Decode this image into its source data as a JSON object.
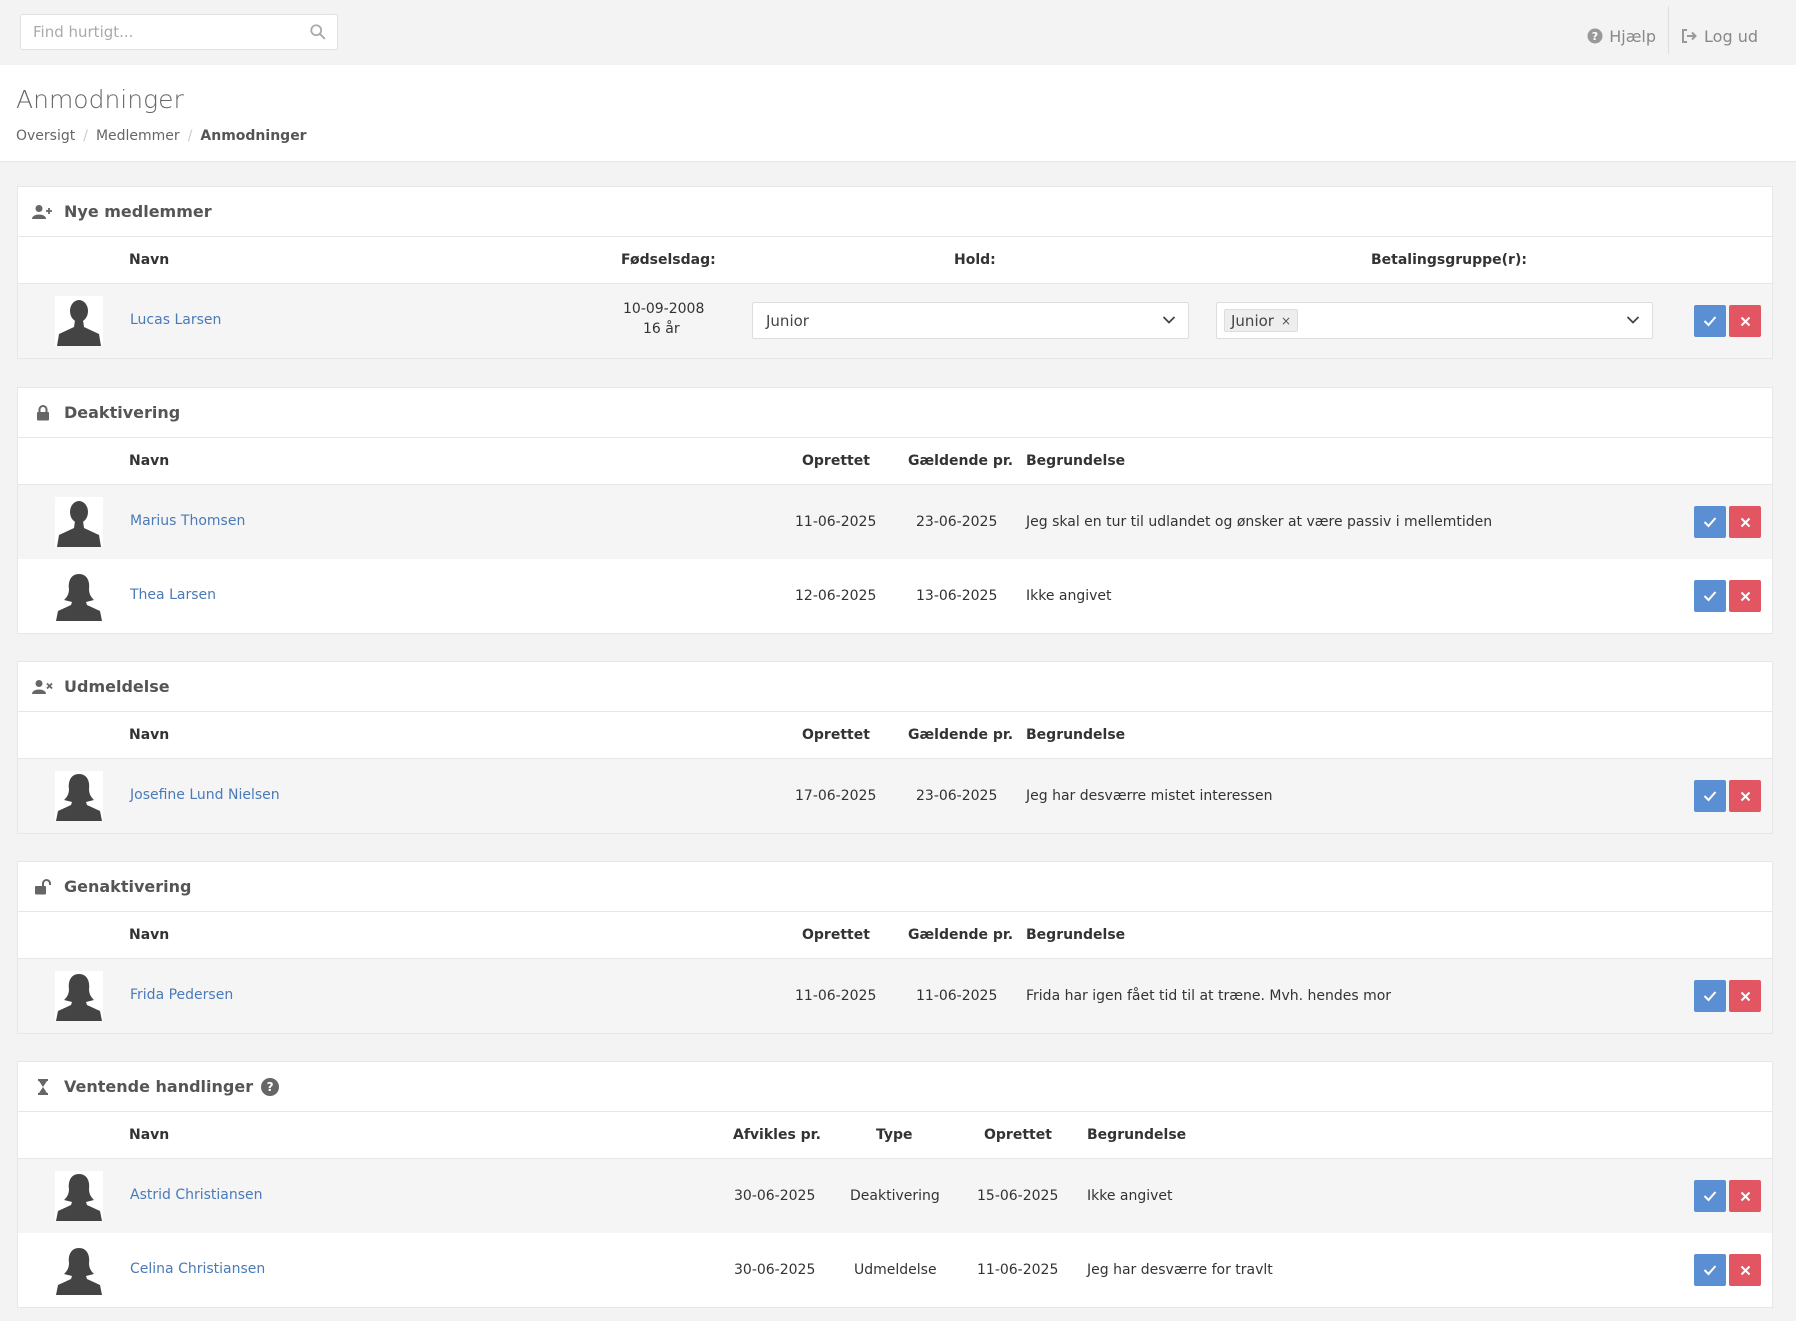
{
  "search": {
    "placeholder": "Find hurtigt..."
  },
  "topnav": {
    "help": "Hjælp",
    "logout": "Log ud"
  },
  "page": {
    "title": "Anmodninger",
    "breadcrumb": [
      "Oversigt",
      "Medlemmer",
      "Anmodninger"
    ]
  },
  "new_members": {
    "title": "Nye medlemmer",
    "headers": {
      "name": "Navn",
      "birthday": "Fødselsdag:",
      "team": "Hold:",
      "payment": "Betalingsgruppe(r):"
    },
    "rows": [
      {
        "name": "Lucas Larsen",
        "birthdate": "10-09-2008",
        "age": "16 år",
        "team": "Junior",
        "payment_tag": "Junior",
        "tag_remove": "×"
      }
    ]
  },
  "deactivation": {
    "title": "Deaktivering",
    "headers": {
      "name": "Navn",
      "created": "Oprettet",
      "effective": "Gældende pr.",
      "reason": "Begrundelse"
    },
    "rows": [
      {
        "name": "Marius Thomsen",
        "created": "11-06-2025",
        "effective": "23-06-2025",
        "reason": "Jeg skal en tur til udlandet og ønsker at være passiv i mellemtiden"
      },
      {
        "name": "Thea Larsen",
        "created": "12-06-2025",
        "effective": "13-06-2025",
        "reason": "Ikke angivet"
      }
    ]
  },
  "resignation": {
    "title": "Udmeldelse",
    "headers": {
      "name": "Navn",
      "created": "Oprettet",
      "effective": "Gældende pr.",
      "reason": "Begrundelse"
    },
    "rows": [
      {
        "name": "Josefine Lund Nielsen",
        "created": "17-06-2025",
        "effective": "23-06-2025",
        "reason": "Jeg har desværre mistet interessen"
      }
    ]
  },
  "reactivation": {
    "title": "Genaktivering",
    "headers": {
      "name": "Navn",
      "created": "Oprettet",
      "effective": "Gældende pr.",
      "reason": "Begrundelse"
    },
    "rows": [
      {
        "name": "Frida Pedersen",
        "created": "11-06-2025",
        "effective": "11-06-2025",
        "reason": "Frida har igen fået tid til at træne. Mvh. hendes mor"
      }
    ]
  },
  "pending": {
    "title": "Ventende handlinger",
    "help_glyph": "?",
    "headers": {
      "name": "Navn",
      "settles": "Afvikles pr.",
      "type": "Type",
      "created": "Oprettet",
      "reason": "Begrundelse"
    },
    "rows": [
      {
        "name": "Astrid Christiansen",
        "settles": "30-06-2025",
        "type": "Deaktivering",
        "created": "15-06-2025",
        "reason": "Ikke angivet"
      },
      {
        "name": "Celina Christiansen",
        "settles": "30-06-2025",
        "type": "Udmeldelse",
        "created": "11-06-2025",
        "reason": "Jeg har desværre for travlt"
      }
    ]
  },
  "colors": {
    "link": "#4a7ab8",
    "approve": "#5b8fd4",
    "reject": "#e25563"
  }
}
